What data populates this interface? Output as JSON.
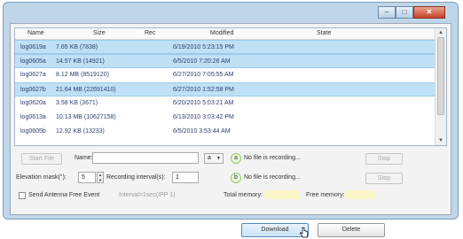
{
  "window": {
    "buttons": {
      "minimize": "–",
      "maximize": "□",
      "close": "✕"
    }
  },
  "list": {
    "columns": [
      "Name",
      "Size",
      "Rec",
      "Modified",
      "State"
    ],
    "rows": [
      {
        "name": "log0619a",
        "size": "7.65 KB (7838)",
        "rec": "",
        "modified": "6/19/2010 5:23:15 PM",
        "selected": true
      },
      {
        "name": "log0605a",
        "size": "14.57 KB (14921)",
        "rec": "",
        "modified": "6/5/2010 7:20:26 AM",
        "selected": true
      },
      {
        "name": "log0627a",
        "size": "8.12 MB (8519120)",
        "rec": "",
        "modified": "6/27/2010 7:05:55 AM",
        "selected": false
      },
      {
        "name": "log0627b",
        "size": "21.64 MB (22691410)",
        "rec": "",
        "modified": "6/27/2010 1:52:58 PM",
        "selected": true
      },
      {
        "name": "log0620a",
        "size": "3.58 KB (3671)",
        "rec": "",
        "modified": "6/20/2010 5:03:21 AM",
        "selected": false
      },
      {
        "name": "log0613a",
        "size": "10.13 MB (10627158)",
        "rec": "",
        "modified": "6/13/2010 3:03:42 PM",
        "selected": false
      },
      {
        "name": "log0605b",
        "size": "12.92 KB (13233)",
        "rec": "",
        "modified": "6/5/2010 3:53:44 AM",
        "selected": false
      }
    ]
  },
  "controls": {
    "start_file": "Start File",
    "name_label": "Name:",
    "name_value": "",
    "name_suffix": "a",
    "elevation_label": "Elevation mask(°):",
    "elevation_value": "5",
    "interval_label": "Recording interval(s):",
    "interval_value": "1",
    "send_label": "Send Antenna Free Event",
    "send_value": "Interval=1sec(IPP 1)",
    "rec_a_badge": "a",
    "rec_a_status": "No file is recording...",
    "rec_b_badge": "b",
    "rec_b_status": "No file is recording...",
    "stop_a": "Stop",
    "stop_b": "Stop",
    "total_memory_label": "Total memory:",
    "free_memory_label": "Free memory:",
    "download": "Download",
    "delete": "Delete"
  }
}
